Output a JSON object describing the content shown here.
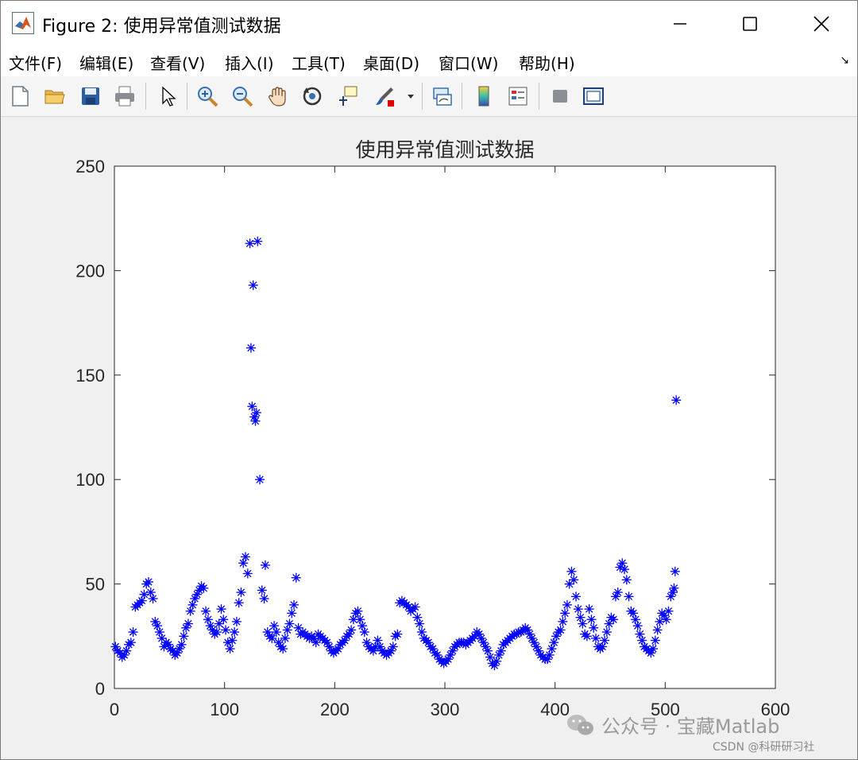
{
  "window": {
    "title": "Figure 2: 使用异常值测试数据",
    "minimize_label": "—",
    "maximize_label": "☐",
    "close_label": "✕"
  },
  "menu": {
    "items": [
      "文件(F)",
      "编辑(E)",
      "查看(V)",
      "插入(I)",
      "工具(T)",
      "桌面(D)",
      "窗口(W)",
      "帮助(H)"
    ],
    "overflow_icon": "arrow-corner-icon"
  },
  "toolbar": {
    "buttons": [
      {
        "name": "new-figure",
        "icon": "new-document-icon"
      },
      {
        "name": "open-file",
        "icon": "folder-icon"
      },
      {
        "name": "save",
        "icon": "save-icon"
      },
      {
        "name": "print",
        "icon": "printer-icon"
      },
      {
        "name": "edit-plot",
        "icon": "cursor-arrow-icon"
      },
      {
        "name": "zoom-in",
        "icon": "zoom-in-icon"
      },
      {
        "name": "zoom-out",
        "icon": "zoom-out-icon"
      },
      {
        "name": "pan",
        "icon": "hand-icon"
      },
      {
        "name": "rotate-3d",
        "icon": "rotate-icon"
      },
      {
        "name": "data-cursor",
        "icon": "data-cursor-icon"
      },
      {
        "name": "brush",
        "icon": "brush-icon"
      },
      {
        "name": "link-plot",
        "icon": "link-plot-icon"
      },
      {
        "name": "colorbar",
        "icon": "colorbar-icon"
      },
      {
        "name": "legend",
        "icon": "legend-icon"
      },
      {
        "name": "hide-plot-tools",
        "icon": "hide-tools-icon"
      },
      {
        "name": "show-plot-tools",
        "icon": "show-tools-icon"
      }
    ]
  },
  "chart_data": {
    "type": "scatter",
    "title": "使用异常值测试数据",
    "xlabel": "",
    "ylabel": "",
    "xlim": [
      0,
      600
    ],
    "ylim": [
      0,
      250
    ],
    "xticks": [
      0,
      100,
      200,
      300,
      400,
      500,
      600
    ],
    "yticks": [
      0,
      50,
      100,
      150,
      200,
      250
    ],
    "marker": "*",
    "color": "#0000ff",
    "grid": false,
    "series": [
      {
        "points": [
          [
            1,
            20
          ],
          [
            3,
            18
          ],
          [
            5,
            17
          ],
          [
            7,
            15
          ],
          [
            9,
            16
          ],
          [
            11,
            18
          ],
          [
            13,
            21
          ],
          [
            15,
            22
          ],
          [
            17,
            27
          ],
          [
            19,
            39
          ],
          [
            21,
            40
          ],
          [
            23,
            41
          ],
          [
            25,
            42
          ],
          [
            27,
            45
          ],
          [
            29,
            50
          ],
          [
            31,
            51
          ],
          [
            33,
            46
          ],
          [
            35,
            43
          ],
          [
            37,
            32
          ],
          [
            39,
            30
          ],
          [
            41,
            27
          ],
          [
            43,
            24
          ],
          [
            45,
            20
          ],
          [
            47,
            22
          ],
          [
            49,
            21
          ],
          [
            51,
            19
          ],
          [
            53,
            18
          ],
          [
            55,
            16
          ],
          [
            57,
            17
          ],
          [
            59,
            19
          ],
          [
            61,
            21
          ],
          [
            63,
            25
          ],
          [
            65,
            29
          ],
          [
            67,
            31
          ],
          [
            69,
            37
          ],
          [
            71,
            40
          ],
          [
            73,
            43
          ],
          [
            75,
            45
          ],
          [
            77,
            47
          ],
          [
            79,
            49
          ],
          [
            81,
            48
          ],
          [
            83,
            37
          ],
          [
            85,
            33
          ],
          [
            87,
            30
          ],
          [
            89,
            28
          ],
          [
            91,
            26
          ],
          [
            93,
            27
          ],
          [
            95,
            31
          ],
          [
            97,
            38
          ],
          [
            99,
            33
          ],
          [
            101,
            28
          ],
          [
            103,
            22
          ],
          [
            105,
            19
          ],
          [
            107,
            23
          ],
          [
            109,
            27
          ],
          [
            111,
            32
          ],
          [
            113,
            41
          ],
          [
            115,
            46
          ],
          [
            117,
            60
          ],
          [
            119,
            63
          ],
          [
            121,
            55
          ],
          [
            123,
            213
          ],
          [
            124,
            163
          ],
          [
            125,
            135
          ],
          [
            126,
            193
          ],
          [
            127,
            130
          ],
          [
            128,
            128
          ],
          [
            129,
            132
          ],
          [
            130,
            214
          ],
          [
            132,
            100
          ],
          [
            134,
            47
          ],
          [
            136,
            43
          ],
          [
            137,
            59
          ],
          [
            139,
            27
          ],
          [
            141,
            25
          ],
          [
            143,
            24
          ],
          [
            145,
            30
          ],
          [
            147,
            27
          ],
          [
            149,
            22
          ],
          [
            151,
            20
          ],
          [
            153,
            19
          ],
          [
            155,
            24
          ],
          [
            157,
            28
          ],
          [
            159,
            31
          ],
          [
            161,
            36
          ],
          [
            163,
            40
          ],
          [
            165,
            53
          ],
          [
            167,
            29
          ],
          [
            169,
            26
          ],
          [
            171,
            27
          ],
          [
            173,
            26
          ],
          [
            175,
            25
          ],
          [
            177,
            24
          ],
          [
            179,
            25
          ],
          [
            181,
            24
          ],
          [
            183,
            22
          ],
          [
            185,
            26
          ],
          [
            187,
            25
          ],
          [
            189,
            24
          ],
          [
            191,
            23
          ],
          [
            193,
            22
          ],
          [
            195,
            20
          ],
          [
            197,
            18
          ],
          [
            199,
            17
          ],
          [
            201,
            18
          ],
          [
            203,
            19
          ],
          [
            205,
            21
          ],
          [
            207,
            22
          ],
          [
            209,
            23
          ],
          [
            211,
            25
          ],
          [
            213,
            26
          ],
          [
            215,
            28
          ],
          [
            217,
            33
          ],
          [
            219,
            36
          ],
          [
            221,
            37
          ],
          [
            223,
            33
          ],
          [
            225,
            30
          ],
          [
            227,
            27
          ],
          [
            229,
            22
          ],
          [
            231,
            20
          ],
          [
            233,
            19
          ],
          [
            235,
            18
          ],
          [
            237,
            20
          ],
          [
            239,
            23
          ],
          [
            241,
            20
          ],
          [
            243,
            18
          ],
          [
            245,
            17
          ],
          [
            247,
            16
          ],
          [
            249,
            17
          ],
          [
            251,
            18
          ],
          [
            253,
            20
          ],
          [
            255,
            25
          ],
          [
            257,
            26
          ],
          [
            259,
            41
          ],
          [
            261,
            42
          ],
          [
            263,
            41
          ],
          [
            265,
            40
          ],
          [
            267,
            39
          ],
          [
            269,
            37
          ],
          [
            271,
            38
          ],
          [
            273,
            39
          ],
          [
            275,
            34
          ],
          [
            277,
            31
          ],
          [
            279,
            27
          ],
          [
            281,
            24
          ],
          [
            283,
            23
          ],
          [
            285,
            22
          ],
          [
            287,
            20
          ],
          [
            289,
            19
          ],
          [
            291,
            17
          ],
          [
            293,
            16
          ],
          [
            295,
            14
          ],
          [
            297,
            13
          ],
          [
            299,
            12
          ],
          [
            301,
            13
          ],
          [
            303,
            14
          ],
          [
            305,
            16
          ],
          [
            307,
            18
          ],
          [
            309,
            20
          ],
          [
            311,
            21
          ],
          [
            313,
            22
          ],
          [
            315,
            22
          ],
          [
            317,
            22
          ],
          [
            319,
            21
          ],
          [
            321,
            22
          ],
          [
            323,
            23
          ],
          [
            325,
            24
          ],
          [
            327,
            25
          ],
          [
            329,
            27
          ],
          [
            331,
            26
          ],
          [
            333,
            24
          ],
          [
            335,
            22
          ],
          [
            337,
            20
          ],
          [
            339,
            18
          ],
          [
            341,
            15
          ],
          [
            343,
            12
          ],
          [
            345,
            11
          ],
          [
            347,
            13
          ],
          [
            349,
            16
          ],
          [
            351,
            18
          ],
          [
            353,
            21
          ],
          [
            355,
            22
          ],
          [
            357,
            23
          ],
          [
            359,
            24
          ],
          [
            361,
            25
          ],
          [
            363,
            26
          ],
          [
            365,
            26
          ],
          [
            367,
            27
          ],
          [
            369,
            27
          ],
          [
            371,
            28
          ],
          [
            373,
            29
          ],
          [
            375,
            28
          ],
          [
            377,
            26
          ],
          [
            379,
            24
          ],
          [
            381,
            22
          ],
          [
            383,
            20
          ],
          [
            385,
            18
          ],
          [
            387,
            16
          ],
          [
            389,
            15
          ],
          [
            391,
            14
          ],
          [
            393,
            14
          ],
          [
            395,
            16
          ],
          [
            397,
            19
          ],
          [
            399,
            22
          ],
          [
            401,
            25
          ],
          [
            403,
            27
          ],
          [
            405,
            28
          ],
          [
            407,
            32
          ],
          [
            409,
            36
          ],
          [
            411,
            40
          ],
          [
            413,
            50
          ],
          [
            415,
            56
          ],
          [
            417,
            52
          ],
          [
            419,
            44
          ],
          [
            421,
            38
          ],
          [
            423,
            34
          ],
          [
            425,
            31
          ],
          [
            427,
            26
          ],
          [
            429,
            25
          ],
          [
            431,
            38
          ],
          [
            433,
            33
          ],
          [
            435,
            29
          ],
          [
            437,
            24
          ],
          [
            439,
            20
          ],
          [
            441,
            19
          ],
          [
            443,
            20
          ],
          [
            445,
            23
          ],
          [
            447,
            27
          ],
          [
            449,
            31
          ],
          [
            451,
            34
          ],
          [
            453,
            33
          ],
          [
            455,
            44
          ],
          [
            457,
            46
          ],
          [
            459,
            58
          ],
          [
            461,
            60
          ],
          [
            463,
            57
          ],
          [
            465,
            52
          ],
          [
            467,
            44
          ],
          [
            469,
            37
          ],
          [
            471,
            36
          ],
          [
            473,
            33
          ],
          [
            475,
            30
          ],
          [
            477,
            26
          ],
          [
            479,
            23
          ],
          [
            481,
            20
          ],
          [
            483,
            19
          ],
          [
            485,
            18
          ],
          [
            487,
            17
          ],
          [
            489,
            19
          ],
          [
            491,
            23
          ],
          [
            493,
            28
          ],
          [
            495,
            32
          ],
          [
            497,
            36
          ],
          [
            499,
            35
          ],
          [
            501,
            33
          ],
          [
            503,
            37
          ],
          [
            505,
            44
          ],
          [
            507,
            46
          ],
          [
            508,
            48
          ],
          [
            509,
            56
          ],
          [
            510,
            138
          ]
        ]
      }
    ]
  },
  "watermark": {
    "icon": "wechat-icon",
    "text": "公众号 · 宝藏Matlab",
    "source": "CSDN @科研研习社"
  }
}
